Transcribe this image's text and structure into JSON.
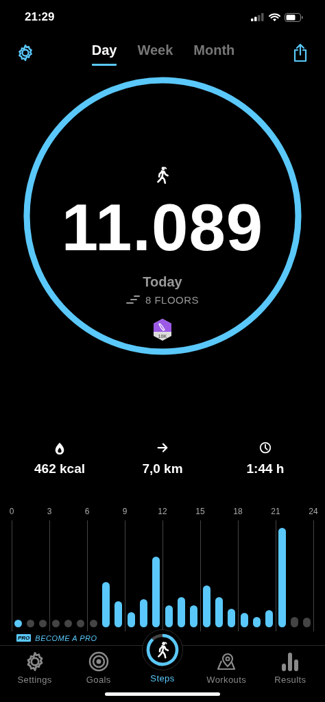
{
  "status_bar": {
    "time": "21:29"
  },
  "header": {
    "tabs": [
      {
        "label": "Day",
        "selected": true
      },
      {
        "label": "Week",
        "selected": false
      },
      {
        "label": "Month",
        "selected": false
      }
    ]
  },
  "summary": {
    "ring": {
      "level": 1
    },
    "steps": "11.089",
    "period": "Today",
    "floors": "8 FLOORS",
    "badge": "10K"
  },
  "stats": [
    {
      "kind": "energy",
      "value": "462 kcal"
    },
    {
      "kind": "distance",
      "value": "7,0 km"
    },
    {
      "kind": "duration",
      "value": "1:44 h"
    }
  ],
  "hour_chart": {
    "ticks": [
      "0",
      "3",
      "6",
      "9",
      "12",
      "15",
      "18",
      "21",
      "24"
    ],
    "bars": [
      {
        "active": true,
        "level": 0.07
      },
      {
        "active": false,
        "level": 0.07
      },
      {
        "active": false,
        "level": 0.07
      },
      {
        "active": false,
        "level": 0.07
      },
      {
        "active": false,
        "level": 0.07
      },
      {
        "active": false,
        "level": 0.07
      },
      {
        "active": false,
        "level": 0.07
      },
      {
        "active": true,
        "level": 0.45
      },
      {
        "active": true,
        "level": 0.26
      },
      {
        "active": true,
        "level": 0.15
      },
      {
        "active": true,
        "level": 0.28
      },
      {
        "active": true,
        "level": 0.71
      },
      {
        "active": true,
        "level": 0.22
      },
      {
        "active": true,
        "level": 0.3
      },
      {
        "active": true,
        "level": 0.22
      },
      {
        "active": true,
        "level": 0.42
      },
      {
        "active": true,
        "level": 0.3
      },
      {
        "active": true,
        "level": 0.18
      },
      {
        "active": true,
        "level": 0.14
      },
      {
        "active": true,
        "level": 0.1
      },
      {
        "active": true,
        "level": 0.17
      },
      {
        "active": true,
        "level": 1
      },
      {
        "active": false,
        "level": 0.1
      },
      {
        "active": false,
        "level": 0.09
      }
    ]
  },
  "pro_banner": {
    "tag": "PRO",
    "text": "BECOME A PRO"
  },
  "tab_bar": [
    {
      "kind": "settings",
      "label": "Settings",
      "selected": false
    },
    {
      "kind": "goals",
      "label": "Goals",
      "selected": false
    },
    {
      "kind": "steps",
      "label": "Steps",
      "selected": true,
      "level": 0.88
    },
    {
      "kind": "workouts",
      "label": "Workouts",
      "selected": false
    },
    {
      "kind": "results",
      "label": "Results",
      "selected": false
    }
  ]
}
